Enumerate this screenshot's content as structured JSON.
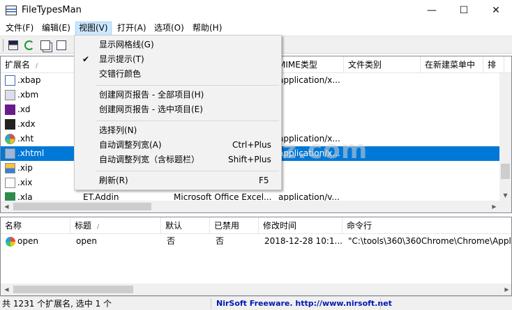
{
  "window": {
    "title": "FileTypesMan",
    "minimize": "—",
    "maximize": "☐",
    "close": "✕"
  },
  "menubar": [
    "文件(F)",
    "编辑(E)",
    "视图(V)",
    "打开(A)",
    "选项(O)",
    "帮助(H)"
  ],
  "toolbar": {
    "buttons": [
      "save-icon",
      "refresh-icon",
      "copy-icon",
      "properties-icon"
    ]
  },
  "list1": {
    "headers": [
      "扩展名",
      "",
      "",
      "MIME类型",
      "文件类别",
      "在新建菜单中",
      "排"
    ],
    "rows": [
      {
        "ext": ".xbap",
        "c1": "",
        "c2": "",
        "mime": "application/x...",
        "selected": false
      },
      {
        "ext": ".xbm",
        "c1": "",
        "c2": "",
        "mime": "",
        "selected": false
      },
      {
        "ext": ".xd",
        "c1": "",
        "c2": "",
        "mime": "",
        "selected": false
      },
      {
        "ext": ".xdx",
        "c1": "",
        "c2": "",
        "mime": "",
        "selected": false
      },
      {
        "ext": ".xht",
        "c1": "",
        "c2": "",
        "mime": "application/x...",
        "selected": false
      },
      {
        "ext": ".xhtml",
        "c1": "",
        "c2": "",
        "mime": "application/x...",
        "selected": true
      },
      {
        "ext": ".xip",
        "c1": "",
        "c2": "",
        "mime": "",
        "selected": false
      },
      {
        "ext": ".xix",
        "c1": "",
        "c2": "",
        "mime": "",
        "selected": false
      },
      {
        "ext": ".xla",
        "c1": "ET.Addin",
        "c2": "Microsoft Office Excel...",
        "mime": "application/v...",
        "selected": false
      }
    ]
  },
  "list2": {
    "headers": [
      "名称",
      "标题",
      "默认",
      "已禁用",
      "修改时间",
      "命令行"
    ],
    "rows": [
      {
        "name": "open",
        "title": "open",
        "default": "否",
        "disabled": "否",
        "modified": "2018-12-28 10:1...",
        "cmd": "\"C:\\tools\\360\\360Chrome\\Chrome\\Appli"
      }
    ]
  },
  "status": {
    "count": "共 1231 个扩展名, 选中 1 个",
    "link": "NirSoft Freeware.  http://www.nirsoft.net"
  },
  "view_menu": {
    "items": [
      {
        "label": "显示网格线(G)",
        "shortcut": "",
        "checked": false
      },
      {
        "label": "显示提示(T)",
        "shortcut": "",
        "checked": true
      },
      {
        "label": "交错行颜色",
        "shortcut": "",
        "checked": false
      },
      {
        "label": "创建网页报告 - 全部项目(H)",
        "shortcut": "",
        "checked": false
      },
      {
        "label": "创建网页报告 - 选中项目(E)",
        "shortcut": "",
        "checked": false
      },
      {
        "label": "选择列(N)",
        "shortcut": "",
        "checked": false
      },
      {
        "label": "自动调整列宽(A)",
        "shortcut": "Ctrl+Plus",
        "checked": false
      },
      {
        "label": "自动调整列宽（含标题栏）",
        "shortcut": "Shift+Plus",
        "checked": false
      },
      {
        "label": "刷新(R)",
        "shortcut": "F5",
        "checked": false
      }
    ],
    "check_mark": "✔"
  },
  "watermark": {
    "mark": "安",
    "text": "anxz.com"
  }
}
